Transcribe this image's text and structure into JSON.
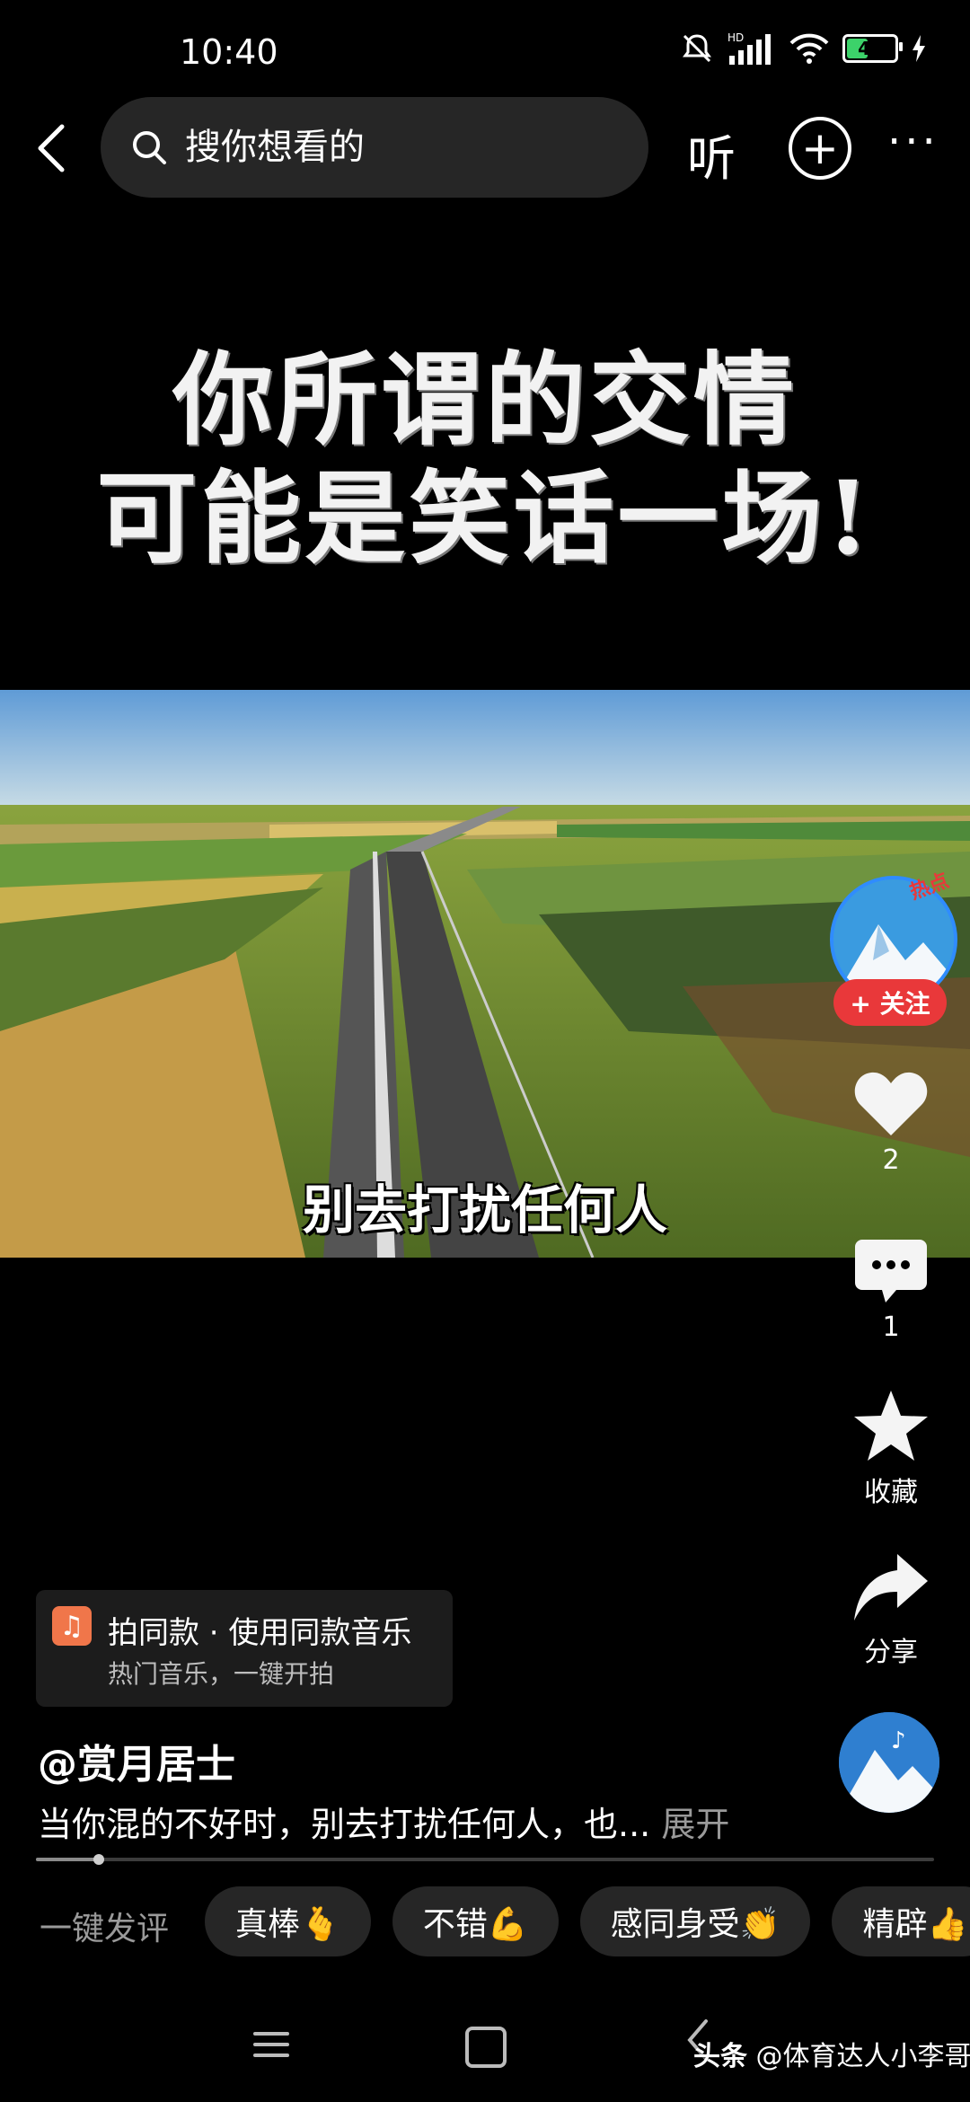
{
  "status_bar": {
    "time": "10:40",
    "battery": "45",
    "battery_level": 0.45,
    "network": "HD"
  },
  "top_bar": {
    "search_placeholder": "搜你想看的",
    "listen_label": "听",
    "add_label": "+",
    "more_label": "···"
  },
  "video": {
    "caption_line1": "你所谓的交情",
    "caption_line2": "可能是笑话一场!",
    "subtitle": "别去打扰任何人"
  },
  "rail": {
    "avatar_badge": "热点",
    "follow_label": "+ 关注",
    "like_count": "2",
    "comment_count": "1",
    "favorite_label": "收藏",
    "share_label": "分享"
  },
  "music": {
    "line1": "拍同款 · 使用同款音乐",
    "line2": "热门音乐，一键开拍"
  },
  "post": {
    "author": "@赏月居士",
    "description": "当你混的不好时，别去打扰任何人，也...",
    "expand_label": "展开",
    "progress": 0.07
  },
  "quick_comment": {
    "label": "一键发评",
    "chips": [
      "真棒🫰",
      "不错💪",
      "感同身受👏",
      "精辟👍"
    ]
  },
  "watermark": {
    "brand": "头条",
    "handle": "@体育达人小李哥"
  },
  "colors": {
    "accent_red": "#e9383a",
    "follow_ring": "#2f8cff",
    "battery_green": "#3cd26a"
  }
}
